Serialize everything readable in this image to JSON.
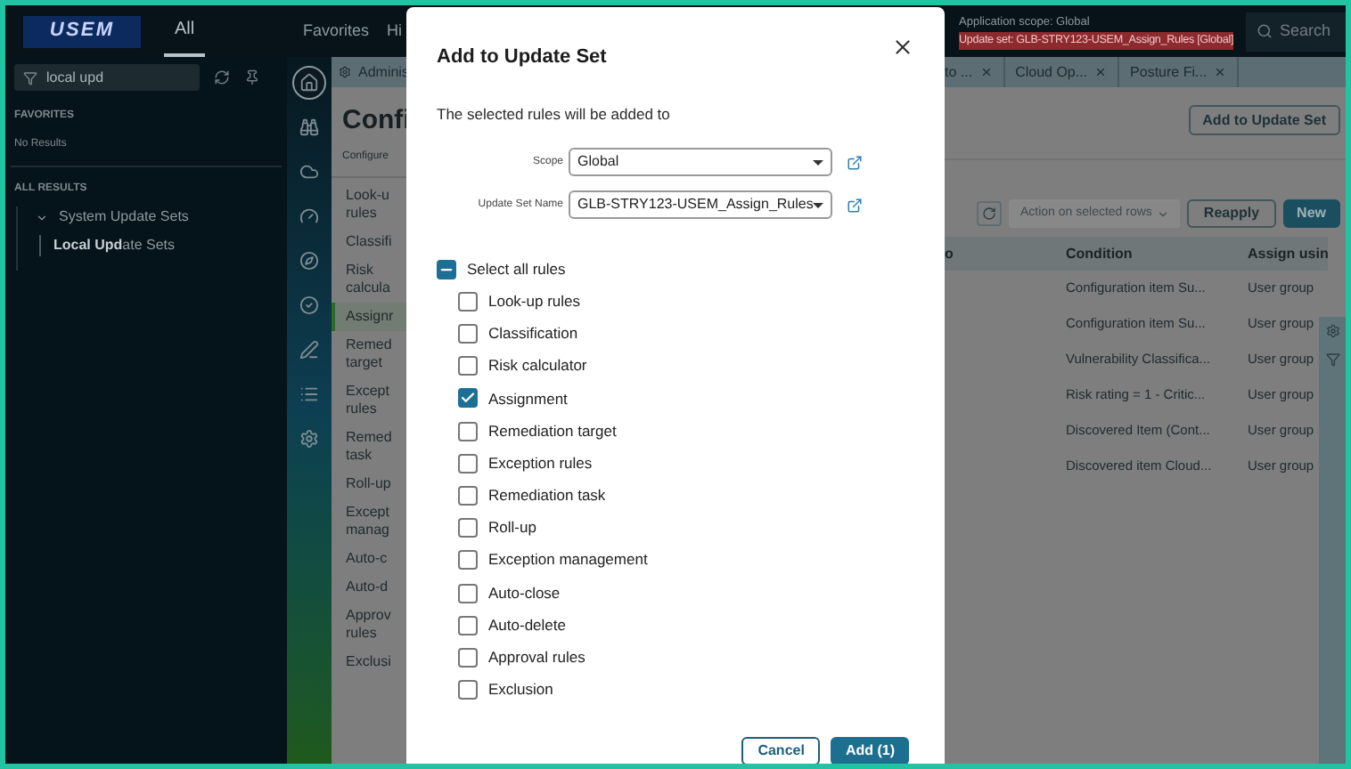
{
  "header": {
    "logo": "USEM",
    "tabs": [
      {
        "label": "All",
        "selected": true
      },
      {
        "label": "Favorites",
        "selected": false
      },
      {
        "label": "Hi",
        "selected": false
      }
    ],
    "scope": "Application scope: Global",
    "update_set": "Update set: GLB-STRY123-USEM_Assign_Rules [Global]",
    "search": {
      "placeholder": "Search"
    }
  },
  "nav": {
    "filter": {
      "value": "local upd"
    },
    "favorites_heading": "FAVORITES",
    "favorites_empty": "No Results",
    "results_heading": "ALL RESULTS",
    "tree": [
      {
        "label": "System Update Sets",
        "expanded": true,
        "children": [
          {
            "label": "**Local Upd**ate Sets"
          }
        ]
      }
    ]
  },
  "rail": [
    {
      "selected": true
    },
    {
      "selected": false
    },
    {
      "selected": false
    },
    {
      "selected": false
    },
    {
      "selected": false
    },
    {
      "selected": false
    },
    {
      "selected": false
    },
    {
      "selected": false
    },
    {
      "selected": false
    }
  ],
  "page_tabs": [
    {
      "label": "Adminis"
    },
    {
      "label": "to ...",
      "closable": true
    },
    {
      "label": "Cloud Op...",
      "closable": true
    },
    {
      "label": "Posture Fi...",
      "closable": true
    }
  ],
  "page": {
    "title": "Confi",
    "subtitle": "Configure",
    "add_button": "Add to Update Set",
    "rules": [
      {
        "label": "Look-u rules",
        "selected": false
      },
      {
        "label": "Classifi",
        "selected": false
      },
      {
        "label": "Risk calcula",
        "selected": false
      },
      {
        "label": "Assignr",
        "selected": true
      },
      {
        "label": "Remed target",
        "selected": false
      },
      {
        "label": "Except rules",
        "selected": false
      },
      {
        "label": "Remed task",
        "selected": false
      },
      {
        "label": "Roll-up",
        "selected": false
      },
      {
        "label": "Except manag",
        "selected": false
      },
      {
        "label": "Auto-c",
        "selected": false
      },
      {
        "label": "Auto-d",
        "selected": false
      },
      {
        "label": "Approv rules",
        "selected": false
      },
      {
        "label": "Exclusi",
        "selected": false
      }
    ],
    "actions": {
      "bulk": {
        "label": "Action on selected rows",
        "disabled": true
      },
      "reapply": "Reapply",
      "new": "New"
    },
    "table": {
      "columns": [
        "o",
        "Condition",
        "Assign usin"
      ],
      "rows": [
        [
          "",
          "Configuration item Su...",
          "User group"
        ],
        [
          "",
          "Configuration item Su...",
          "User group"
        ],
        [
          "",
          "Vulnerability Classifica...",
          "User group"
        ],
        [
          "",
          "Risk rating = 1 - Critic...",
          "User group"
        ],
        [
          "",
          "Discovered Item (Cont...",
          "User group"
        ],
        [
          "",
          "Discovered item Cloud...",
          "User group"
        ]
      ]
    }
  },
  "dialog": {
    "title": "Add to Update Set",
    "intro": "The selected rules will be added to",
    "fields": [
      {
        "label": "Scope",
        "value": "Global"
      },
      {
        "label": "Update Set Name",
        "value": "GLB-STRY123-USEM_Assign_Rules"
      }
    ],
    "select_all": {
      "label": "Select all rules",
      "indeterminate": true
    },
    "options": [
      {
        "label": "Look-up rules",
        "checked": false
      },
      {
        "label": "Classification",
        "checked": false
      },
      {
        "label": "Risk calculator",
        "checked": false
      },
      {
        "label": "Assignment",
        "checked": true
      },
      {
        "label": "Remediation target",
        "checked": false
      },
      {
        "label": "Exception rules",
        "checked": false
      },
      {
        "label": "Remediation task",
        "checked": false
      },
      {
        "label": "Roll-up",
        "checked": false
      },
      {
        "label": "Exception management",
        "checked": false
      },
      {
        "label": "Auto-close",
        "checked": false
      },
      {
        "label": "Auto-delete",
        "checked": false
      },
      {
        "label": "Approval rules",
        "checked": false
      },
      {
        "label": "Exclusion",
        "checked": false
      }
    ],
    "buttons": [
      {
        "label": "Cancel",
        "kind": "secondary"
      },
      {
        "label": "Add (1)",
        "kind": "primary"
      }
    ]
  }
}
